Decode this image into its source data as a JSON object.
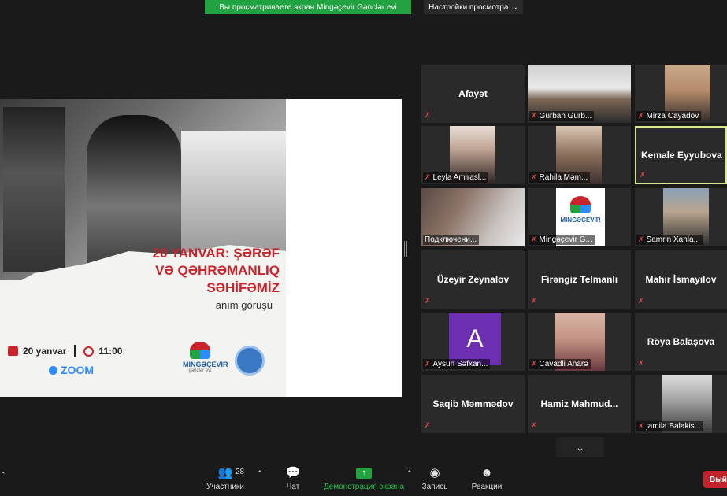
{
  "banner": {
    "share_text": "Вы просматриваете экран Mingəçevir Gənclər evi",
    "view_options": "Настройки просмотра"
  },
  "poster": {
    "title_line1": "20 YANVAR: ŞƏRƏF",
    "title_line2": "VƏ QƏHRƏMANLIQ",
    "title_line3": "SƏHİFƏMİZ",
    "subtitle": "anım görüşü",
    "date": "20 yanvar",
    "time": "11:00",
    "platform": "ZOOM",
    "logo_text": "MINGƏÇEVIR",
    "logo_subtext": "gənclər evi",
    "colors": {
      "accent": "#c9232c",
      "zoom": "#2d8cff"
    }
  },
  "participants": [
    {
      "name": "Afayət",
      "has_video": false,
      "label_visible": false
    },
    {
      "name": "Gurban Gurb...",
      "has_video": true,
      "label_visible": true
    },
    {
      "name": "Mirza Cayadov",
      "has_video": true,
      "label_visible": true
    },
    {
      "name": "Leyla Amirasl...",
      "has_video": true,
      "label_visible": true
    },
    {
      "name": "Rahila Məm...",
      "has_video": true,
      "label_visible": true
    },
    {
      "name": "Kemale Eyyubova",
      "has_video": false,
      "label_visible": false,
      "active_speaker": true
    },
    {
      "name": "Подключени...",
      "has_video": true,
      "label_visible": true
    },
    {
      "name": "Mingəçevir G...",
      "has_video": true,
      "label_visible": true
    },
    {
      "name": "Samrin Xanla...",
      "has_video": true,
      "label_visible": true
    },
    {
      "name": "Üzeyir Zeynalov",
      "has_video": false,
      "label_visible": false
    },
    {
      "name": "Firəngiz Telmanlı",
      "has_video": false,
      "label_visible": false
    },
    {
      "name": "Mahir İsmayılov",
      "has_video": false,
      "label_visible": false
    },
    {
      "name": "Aysun Səfxan...",
      "has_video": true,
      "avatar_letter": "A",
      "label_visible": true
    },
    {
      "name": "Cavadli Anarə",
      "has_video": true,
      "label_visible": true
    },
    {
      "name": "Röya Balaşova",
      "has_video": false,
      "label_visible": false
    },
    {
      "name": "Saqib Məmmədov",
      "has_video": false,
      "label_visible": false
    },
    {
      "name": "Hamiz  Mahmud...",
      "has_video": false,
      "label_visible": false
    },
    {
      "name": "jamila Balakis...",
      "has_video": true,
      "label_visible": true
    }
  ],
  "toolbar": {
    "participants_label": "Участники",
    "participants_count": "28",
    "chat_label": "Чат",
    "share_label": "Демонстрация экрана",
    "record_label": "Запись",
    "reactions_label": "Реакции",
    "end_label": "Вый"
  },
  "icons": {
    "muted_mic": "muted-mic-icon",
    "participants": "participants-icon",
    "chat": "chat-icon",
    "share": "share-screen-icon",
    "record": "record-icon",
    "reactions": "reactions-icon",
    "more": "chevron-down-icon"
  }
}
